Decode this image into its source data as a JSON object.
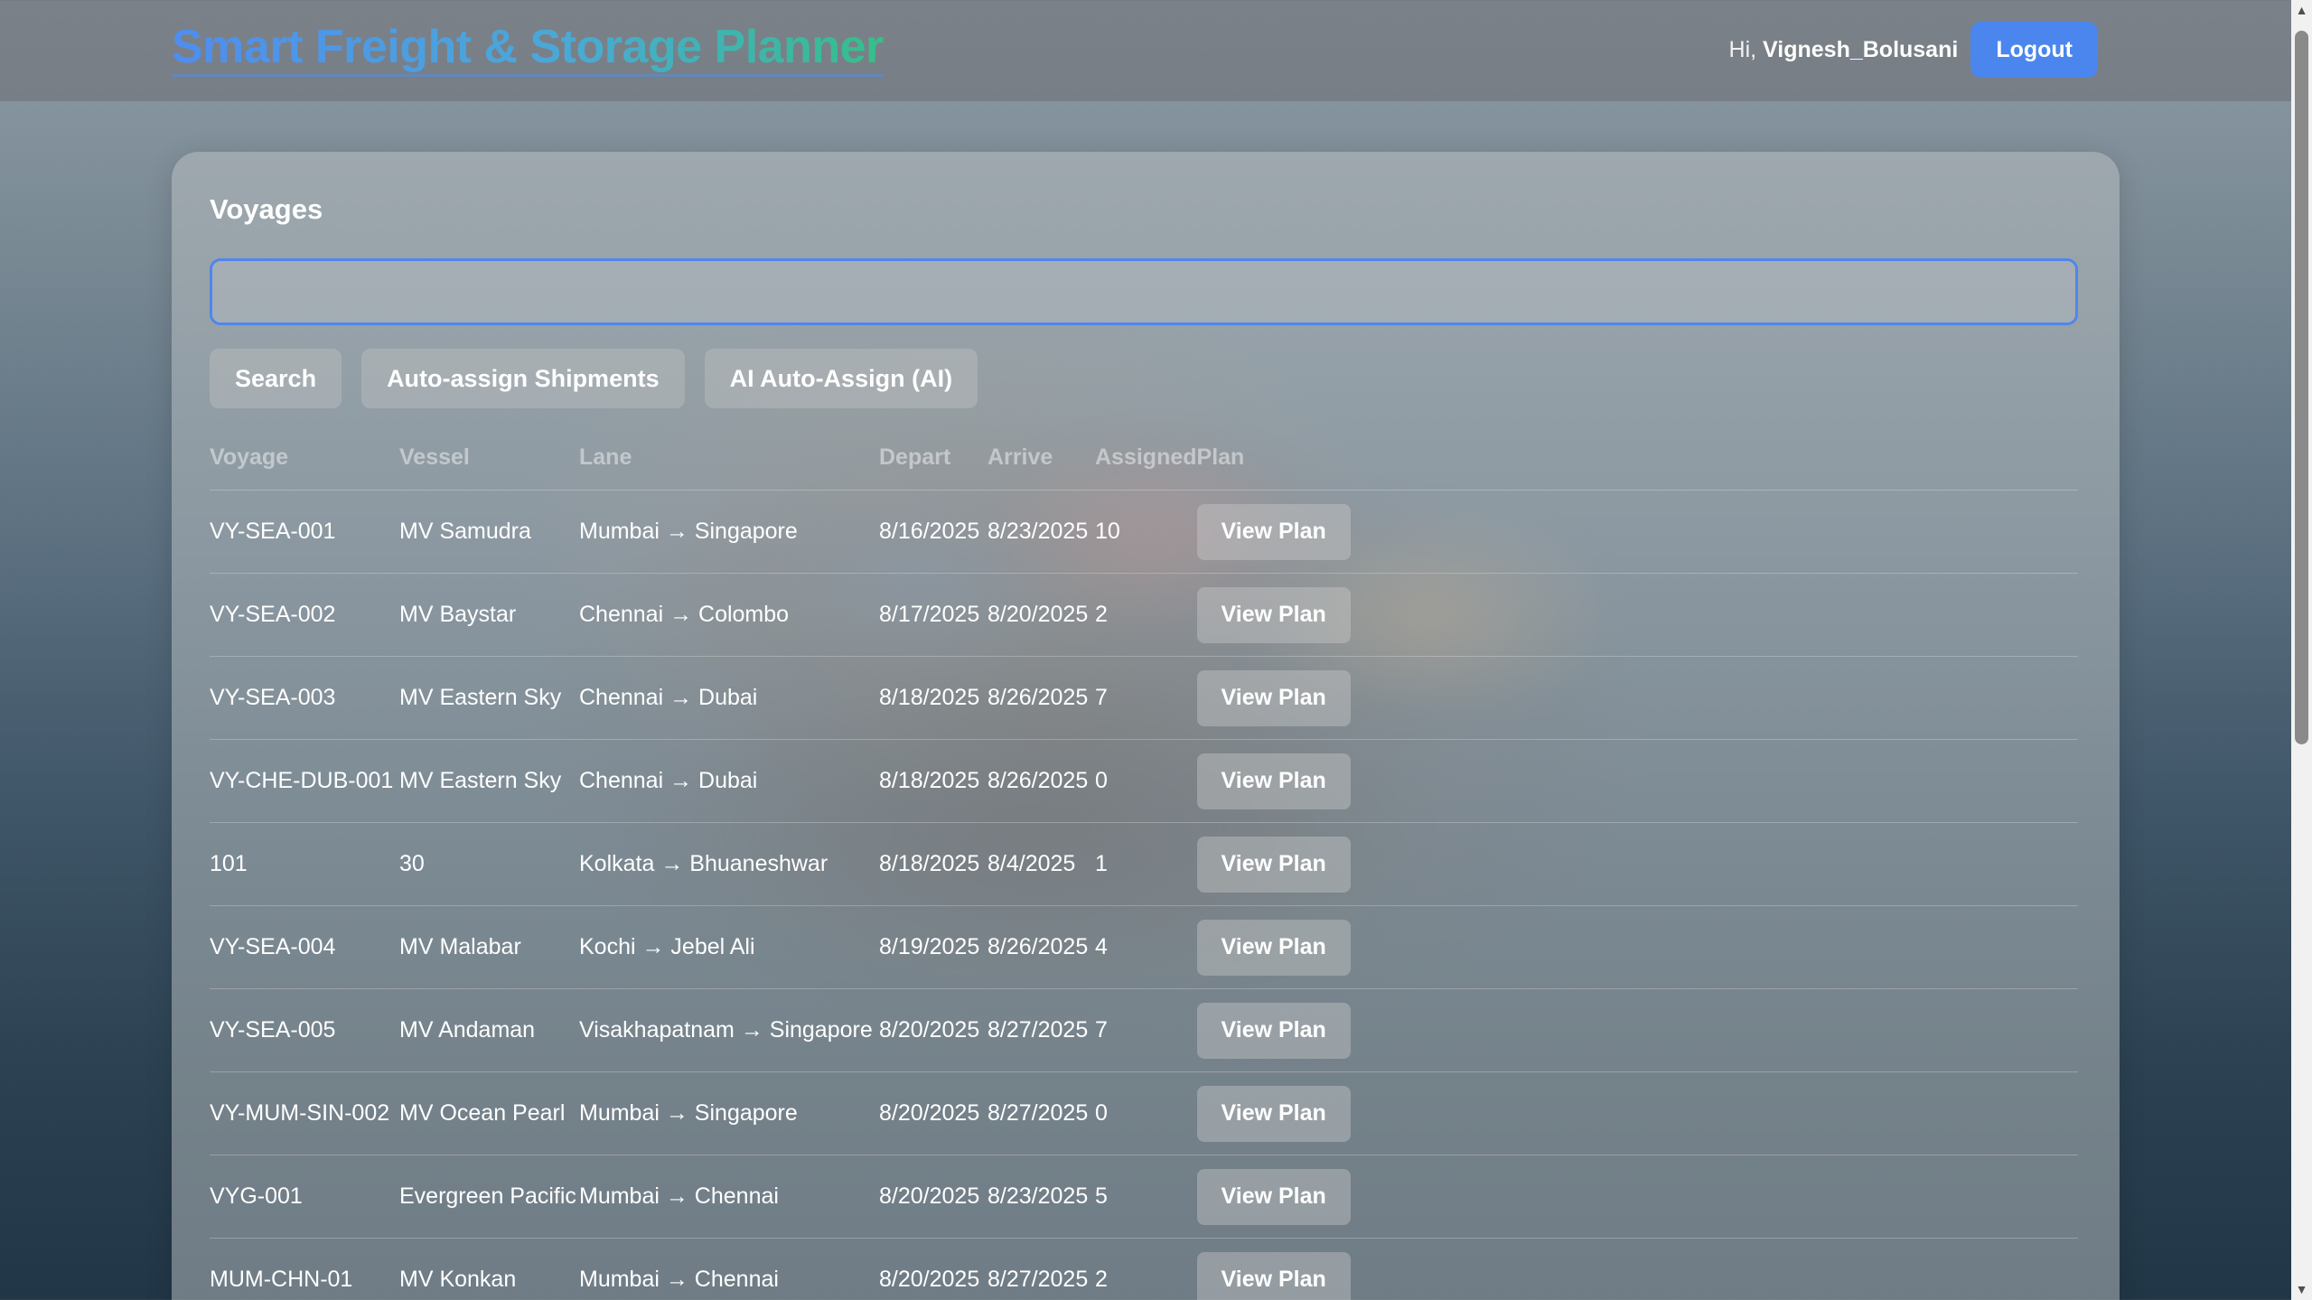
{
  "header": {
    "brand": "Smart Freight & Storage Planner",
    "greeting_prefix": "Hi,",
    "username": "Vignesh_Bolusani",
    "logout_label": "Logout"
  },
  "voyages_panel": {
    "title": "Voyages",
    "search_value": "",
    "buttons": {
      "search": "Search",
      "auto_assign": "Auto-assign Shipments",
      "ai_auto_assign": "AI Auto-Assign (AI)"
    },
    "columns": [
      "Voyage",
      "Vessel",
      "Lane",
      "Depart",
      "Arrive",
      "Assigned",
      "Plan"
    ],
    "rows": [
      {
        "voyage": "VY-SEA-001",
        "vessel": "MV Samudra",
        "lane": "Mumbai → Singapore",
        "depart": "8/16/2025",
        "arrive": "8/23/2025",
        "assigned": "10",
        "plan": "View Plan"
      },
      {
        "voyage": "VY-SEA-002",
        "vessel": "MV Baystar",
        "lane": "Chennai → Colombo",
        "depart": "8/17/2025",
        "arrive": "8/20/2025",
        "assigned": "2",
        "plan": "View Plan"
      },
      {
        "voyage": "VY-SEA-003",
        "vessel": "MV Eastern Sky",
        "lane": "Chennai → Dubai",
        "depart": "8/18/2025",
        "arrive": "8/26/2025",
        "assigned": "7",
        "plan": "View Plan"
      },
      {
        "voyage": "VY-CHE-DUB-001",
        "vessel": "MV Eastern Sky",
        "lane": "Chennai → Dubai",
        "depart": "8/18/2025",
        "arrive": "8/26/2025",
        "assigned": "0",
        "plan": "View Plan"
      },
      {
        "voyage": "101",
        "vessel": "30",
        "lane": "Kolkata → Bhuaneshwar",
        "depart": "8/18/2025",
        "arrive": "8/4/2025",
        "assigned": "1",
        "plan": "View Plan"
      },
      {
        "voyage": "VY-SEA-004",
        "vessel": "MV Malabar",
        "lane": "Kochi → Jebel Ali",
        "depart": "8/19/2025",
        "arrive": "8/26/2025",
        "assigned": "4",
        "plan": "View Plan"
      },
      {
        "voyage": "VY-SEA-005",
        "vessel": "MV Andaman",
        "lane": "Visakhapatnam → Singapore",
        "depart": "8/20/2025",
        "arrive": "8/27/2025",
        "assigned": "7",
        "plan": "View Plan"
      },
      {
        "voyage": "VY-MUM-SIN-002",
        "vessel": "MV Ocean Pearl",
        "lane": "Mumbai → Singapore",
        "depart": "8/20/2025",
        "arrive": "8/27/2025",
        "assigned": "0",
        "plan": "View Plan"
      },
      {
        "voyage": "VYG-001",
        "vessel": "Evergreen Pacific",
        "lane": "Mumbai → Chennai",
        "depart": "8/20/2025",
        "arrive": "8/23/2025",
        "assigned": "5",
        "plan": "View Plan"
      },
      {
        "voyage": "MUM-CHN-01",
        "vessel": "MV Konkan",
        "lane": "Mumbai → Chennai",
        "depart": "8/20/2025",
        "arrive": "8/27/2025",
        "assigned": "2",
        "plan": "View Plan"
      }
    ]
  },
  "colors": {
    "accent": "#4a86ee",
    "brand_gradient_start": "#4f8df0",
    "brand_gradient_end": "#34c08a"
  },
  "scrollbar": {
    "up_icon": "scroll-up-arrow-icon",
    "down_icon": "scroll-down-arrow-icon"
  }
}
